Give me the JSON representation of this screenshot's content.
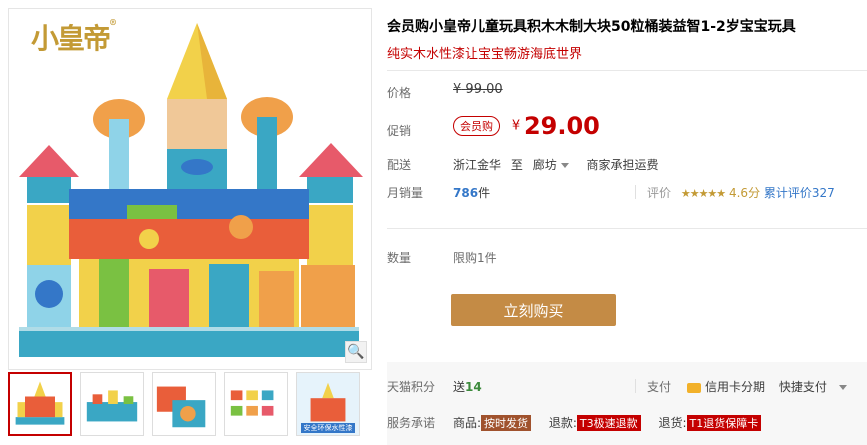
{
  "gallery": {
    "brand": "小皇帝",
    "brand_mark": "®",
    "zoom_icon": "search-icon",
    "thumb_badge": "安全环保水性漆"
  },
  "product": {
    "title": "会员购小皇帝儿童玩具积木木制大块50粒桶装益智1-2岁宝宝玩具",
    "subtitle": "纯实木水性漆让宝宝畅游海底世界"
  },
  "price": {
    "label": "价格",
    "currency": "¥",
    "original": "99.00"
  },
  "promo": {
    "label": "促销",
    "badge": "会员购",
    "currency": "¥",
    "price": "29.00"
  },
  "delivery": {
    "label": "配送",
    "from": "浙江金华",
    "to_word": "至",
    "to": "廊坊",
    "fee": "商家承担运费"
  },
  "stats": {
    "sales_label": "月销量",
    "sales_count": "786",
    "sales_unit": "件",
    "rating_label": "评价",
    "stars": "★★★★★",
    "score": "4.6分",
    "reviews": "累计评价327"
  },
  "quantity": {
    "label": "数量",
    "limit": "限购1件"
  },
  "actions": {
    "buy": "立刻购买"
  },
  "points": {
    "label": "天猫积分",
    "give": "送",
    "value": "14"
  },
  "payment": {
    "label": "支付",
    "card": "信用卡分期",
    "quick": "快捷支付"
  },
  "service": {
    "label": "服务承诺",
    "item1_prefix": "商品:",
    "item1_tag": "按时发货",
    "item2_prefix": "退款:",
    "item2_tag": "T3极速退款",
    "item3_prefix": "退货:",
    "item3_tag": "T1退货保障卡"
  },
  "colors": {
    "accent_red": "#c40000",
    "buy_button": "#c48b45",
    "link_blue": "#3477c8",
    "gold": "#c39a35"
  }
}
